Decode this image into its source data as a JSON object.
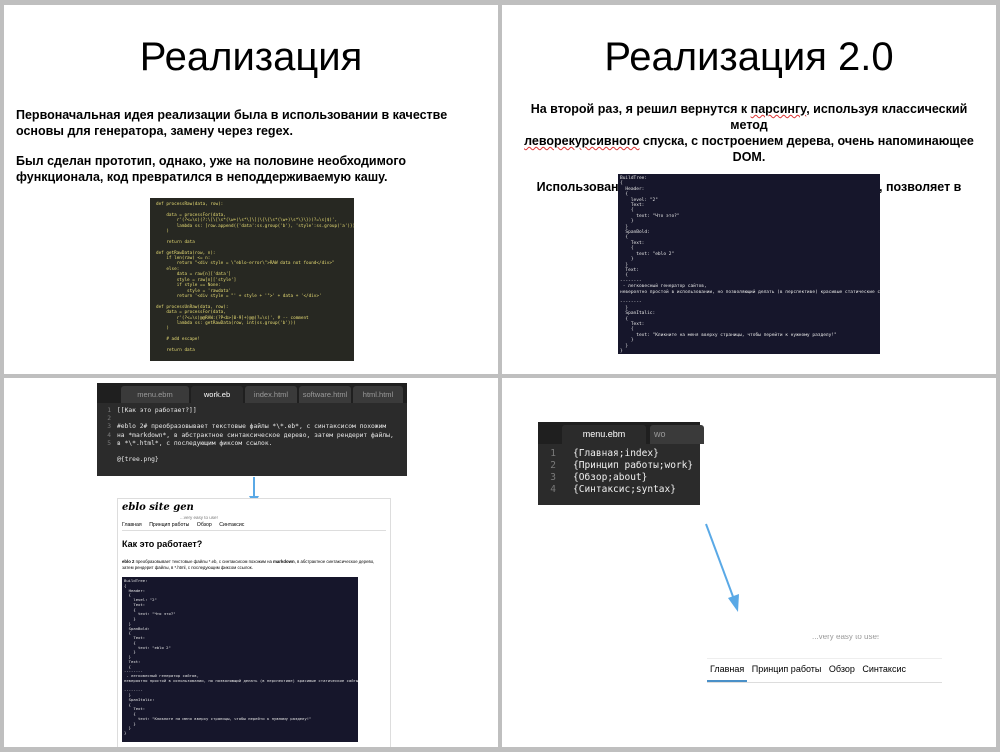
{
  "slide1": {
    "title": "Реализация",
    "para1": "Первоначальная идея реализации была в использовании в качестве основы для генератора, замену через regex.",
    "para2": "Был сделан прототип, однако, уже на половине необходимого функционала, код превратился в неподдерживаемую кашу.",
    "code_lines": [
      "def processRaw(data, row):",
      "",
      "    data = processFor(data,",
      "        r'(?<=\\s)(?:\\[\\[\\s*(\\w+)\\s*\\]\\]|\\{\\{\\s*(\\w+)\\s*\\}\\})(?=\\s|$)',",
      "        lambda ss: [row.append({'data':ss.group('b'), 'style':ss.group('a')})]",
      "    )",
      "",
      "    return data",
      "",
      "def getRawData(row, n):",
      "    if len(raw) <= n:",
      "        return \"<div style = \\\"eblo-error\\\">RAW data not found</div>\"",
      "    else:",
      "        data = raw[n]['data']",
      "        style = raw[n]['style']",
      "        if style == None:",
      "            style = 'rawdata'",
      "        return '<div style = \"' + style + '\">' + data + '</div>'",
      "",
      "def processUnRaw(data, row):",
      "    data = processFor(data,",
      "        r'(?<=\\s)@@RAW:(?P<b>[0-9]+)@@(?=\\s)', # -- comment",
      "        lambda ss: getRawData(row, int(ss.group('b')))",
      "    )",
      "",
      "    # add escape!",
      "",
      "    return data"
    ]
  },
  "slide2": {
    "title": "Реализация 2.0",
    "para1_a": "На второй раз, я решил вернутся к ",
    "para1_link": "парсингу",
    "para1_b": ", используя классический метод",
    "para1_c": "леворекурсивного",
    "para1_d": " спуска, с построением дерева, очень напоминающее DOM.",
    "para2": "Использование полноценного синтаксического дерева, позволяет в перспективе прикрутить любой рендер.",
    "tree_lines": [
      "BuildTree:",
      "{",
      "  Header:",
      "  {",
      "    level: \"2\"",
      "    Text:",
      "    {",
      "      text: \"Что это?\"",
      "    }",
      "  }",
      "  SpanBold:",
      "  {",
      "    Text:",
      "    {",
      "      text: \"eblo 2\"",
      "    }",
      "  }",
      "  Text:",
      "  {",
      "--------",
      " - легковесный генератор сайтов,",
      "невероятно простой в использовании, но позволяющий делать (в перспективе) красивые статические сайты.",
      "",
      "--------",
      "  }",
      "  SpanItalic:",
      "  {",
      "    Text:",
      "    {",
      "      text: \"Кликните на меня вверху страницы, чтобы перейти к нужному разделу!\"",
      "    }",
      "  }",
      "}"
    ]
  },
  "slide3": {
    "tabs": [
      "menu.ebm",
      "work.eb",
      "index.html",
      "software.html",
      "html.html"
    ],
    "active_tab": "work.eb",
    "gutter": [
      "1",
      "2",
      "3",
      "",
      "",
      "4",
      "5"
    ],
    "editor_lines": [
      "[[Как это работает?]]",
      "",
      "#eblo 2# преобразовывает текстовые файлы *\\*.eb*, с синтаксисом похожим",
      "на *markdown*, в абстрактное синтаксическое дерево, затем рендерит файлы,",
      "в *\\*.html*, с последующим фиксом ссылок.",
      "",
      "@{tree.png}"
    ],
    "site": {
      "logo": "eblo site gen",
      "tagline": "...very easy to use!",
      "nav": [
        "Главная",
        "Принцип работы",
        "Обзор",
        "Синтаксис"
      ],
      "heading": "Как это работает?",
      "body_bold": "eblo 2",
      "body_a": " преобразовывает текстовые файлы *.eb, с синтаксисом похожим на ",
      "body_bold2": "markdown",
      "body_b": ", в абстрактное синтаксическое дерево, затем рендерит файлы, в *.html, с последующим фиксом ссылок."
    }
  },
  "slide4": {
    "tab_active": "menu.ebm",
    "tab_other": "wo",
    "gutter": [
      "1",
      "2",
      "3",
      "4"
    ],
    "editor_lines": [
      "{Главная;index}",
      "{Принцип работы;work}",
      "{Обзор;about}",
      "{Синтаксис;syntax}"
    ],
    "tagline_fragment": "...very easy to use!",
    "nav": [
      "Главная",
      "Принцип работы",
      "Обзор",
      "Синтаксис"
    ]
  },
  "colors": {
    "arrow": "#5aa9e6",
    "tree_bg": "#16162b",
    "editor_bg": "#2b2b2b",
    "nav_underline": "#4a90c8"
  }
}
